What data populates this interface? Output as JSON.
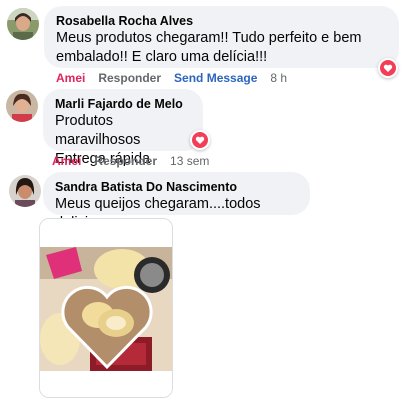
{
  "comments": [
    {
      "author": "Rosabella Rocha Alves",
      "text": "Meus produtos chegaram!! Tudo perfeito e bem embalado!! E claro uma delícia!!!",
      "line1": "Meus produtos chegaram!! Tudo perfeito e bem",
      "line2": "embalado!! E claro uma delícia!!!",
      "actions": {
        "like": "Amei",
        "reply": "Responder",
        "send": "Send Message",
        "time": "8 h"
      },
      "reaction": "heart"
    },
    {
      "author": "Marli Fajardo de Melo",
      "line1": "Produtos maravilhosos",
      "line2": "Entrega rápida",
      "actions": {
        "like": "Amei",
        "reply": "Responder",
        "time": "13 sem"
      },
      "reaction": "heart"
    },
    {
      "author": "Sandra Batista Do Nascimento",
      "line1": "Meus queijos chegaram....todos deliciosos",
      "attachment": "photo of cheese package"
    }
  ],
  "colors": {
    "bubble": "#f0f2f5",
    "like": "#e0245e",
    "send": "#2d64bc",
    "meta": "#65676b",
    "reaction": "#f33e58"
  }
}
